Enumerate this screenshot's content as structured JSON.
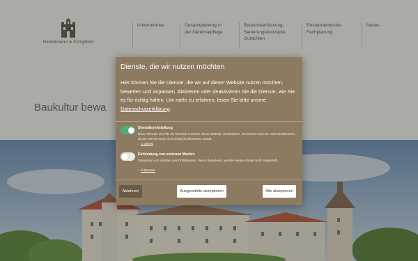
{
  "site": {
    "logo_text": "Heidelmann & Klingebiel",
    "nav": [
      {
        "label": "Unternehmen"
      },
      {
        "label": "Gesamtplanung in\nder Denkmalpflege"
      },
      {
        "label": "Bestandserfassung,\nSanierungskonzepte,\nGutachten"
      },
      {
        "label": "Restauratorische\nFachplanung"
      },
      {
        "label": "Neues"
      }
    ],
    "hero_title": "Baukultur bewa"
  },
  "consent": {
    "title": "Dienste, die wir nutzen möchten",
    "intro": "Hier können Sie die Dienste, die wir auf dieser Website nutzen möchten, bewerten und anpassen. Aktivieren oder deaktivieren Sie die Dienste, wie Sie es für richtig halten. Um mehr zu erfahren, lesen Sie bitte unsere ",
    "privacy_link": "Datenschutzerklärung",
    "intro_end": ".",
    "services": [
      {
        "title": "Dienstbereitstellung",
        "description": "Diese Dienste sind für die korrekte Funktion dieser Website unerlässlich. Sie können sie hier nicht deaktivieren, da der Dienst sonst nicht richtig funktionieren würde.",
        "count": "1 Dienst",
        "enabled": true
      },
      {
        "title": "Einbindung von externen Medien",
        "description": "Integration von Inhalten aus Drittdiensten. Wenn deaktiviert, werden einige Inhalte nicht dargestellt.",
        "count": "2 Dienste",
        "enabled": false
      }
    ],
    "buttons": {
      "reject": "Ablehnen",
      "accept_selected": "Ausgewählte akzeptieren",
      "accept_all": "Alle akzeptieren"
    },
    "colors": {
      "modal_bg": "#8d7b61",
      "toggle_on": "#4fae78",
      "reject_bg": "#6a5b47"
    }
  }
}
